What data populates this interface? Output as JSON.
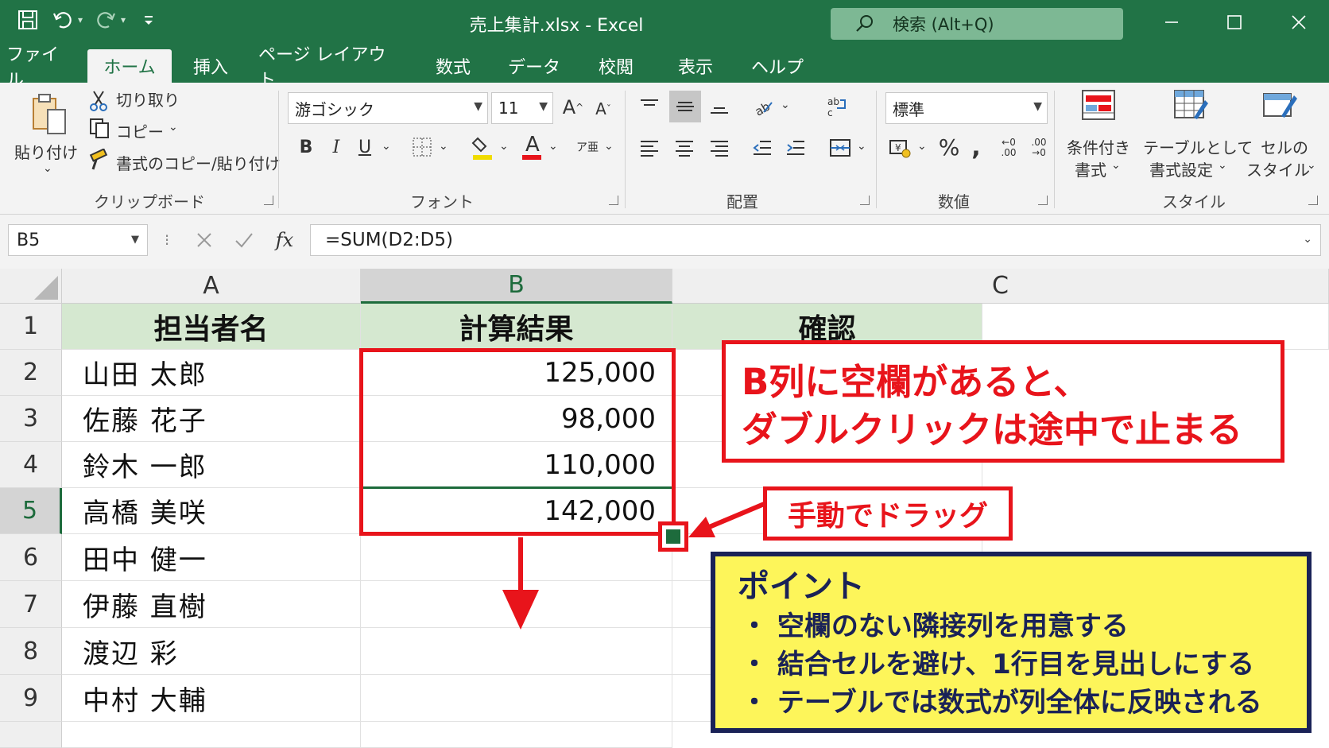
{
  "app": {
    "window_title": "売上集計.xlsx  -  Excel",
    "search_label": "検索 (Alt+Q)"
  },
  "tabs": [
    "ファイル",
    "ホーム",
    "挿入",
    "ページ レイアウト",
    "数式",
    "データ",
    "校閲",
    "表示",
    "ヘルプ"
  ],
  "active_tab": "ホーム",
  "ribbon": {
    "clipboard": {
      "paste": "貼り付け",
      "cut": "切り取り",
      "copy": "コピー",
      "format_painter": "書式のコピー/貼り付け",
      "group_label": "クリップボード"
    },
    "font": {
      "font_name": "游ゴシック",
      "font_size": "11",
      "group_label": "フォント",
      "underline_color": "#f0dc00",
      "font_color": "#e8141b"
    },
    "alignment": {
      "group_label": "配置"
    },
    "number": {
      "format": "標準",
      "group_label": "数値"
    },
    "styles": {
      "conditional_formatting_1": "条件付き",
      "conditional_formatting_2": "書式",
      "format_as_table_1": "テーブルとして",
      "format_as_table_2": "書式設定",
      "cell_styles_1": "セルの",
      "cell_styles_2": "スタイル",
      "group_label": "スタイル"
    }
  },
  "formula_bar": {
    "name_box": "B5",
    "fx_label": "fx",
    "formula": "=SUM(D2:D5)"
  },
  "sheet": {
    "columns": [
      "A",
      "B",
      "C"
    ],
    "rows": [
      "1",
      "2",
      "3",
      "4",
      "5",
      "6",
      "7",
      "8",
      "9"
    ],
    "headers": {
      "a": "担当者名",
      "b": "計算結果",
      "c": "確認"
    },
    "names": [
      "山田 太郎",
      "佐藤 花子",
      "鈴木 一郎",
      "高橋 美咲",
      "田中 健一",
      "伊藤 直樹",
      "渡辺 彩",
      "中村 大輔"
    ],
    "results": [
      "125,000",
      "98,000",
      "110,000",
      "142,000"
    ],
    "active_cell": "B5"
  },
  "annotations": {
    "warning_line1": "B列に空欄があると、",
    "warning_line2": "ダブルクリックは途中で止まる",
    "drag_label": "手動でドラッグ",
    "point_title": "ポイント",
    "point_items": [
      "・ 空欄のない隣接列を用意する",
      "・ 結合セルを避け、1行目を見出しにする",
      "・ テーブルでは数式が列全体に反映される"
    ],
    "colors": {
      "red": "#e8141b",
      "navy": "#1a2257",
      "yellow": "#fdf55a",
      "excel_green": "#217346"
    }
  }
}
